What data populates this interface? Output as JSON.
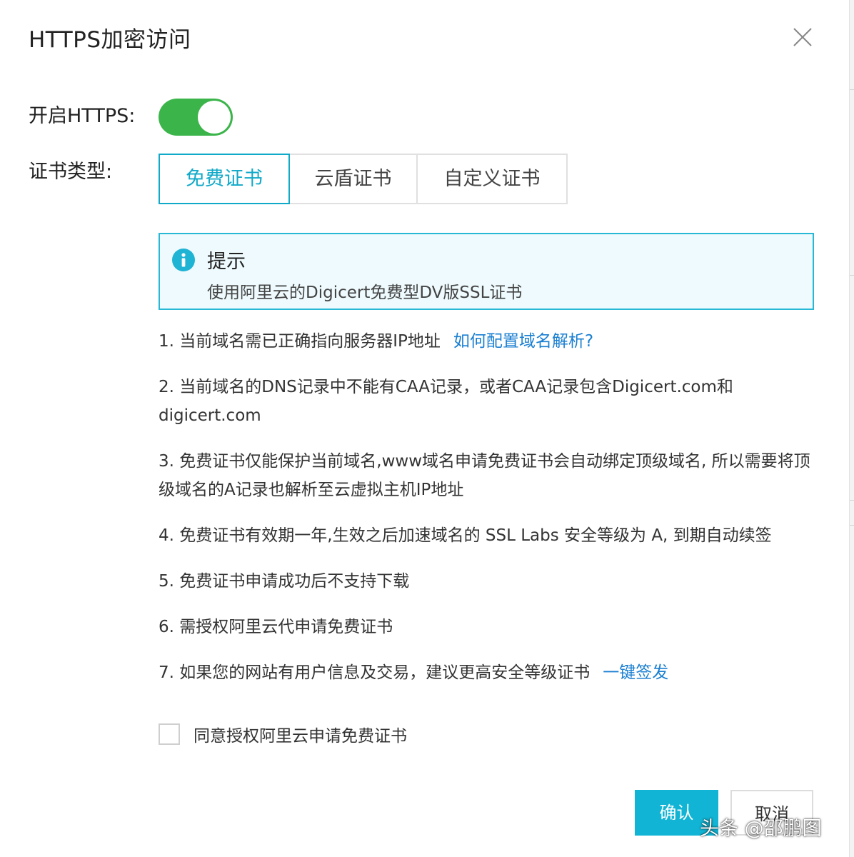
{
  "dialog": {
    "title": "HTTPS加密访问",
    "close_icon": "close-icon"
  },
  "https": {
    "label": "开启HTTPS:",
    "enabled": true,
    "switch_color": "#3bb54a"
  },
  "cert_type": {
    "label": "证书类型:",
    "tabs": [
      {
        "label": "免费证书",
        "active": true
      },
      {
        "label": "云盾证书",
        "active": false
      },
      {
        "label": "自定义证书",
        "active": false
      }
    ],
    "accent": "#11a9c8"
  },
  "tip": {
    "icon": "info-icon",
    "title": "提示",
    "text": "使用阿里云的Digicert免费型DV版SSL证书"
  },
  "notes": [
    {
      "text": "1. 当前域名需已正确指向服务器IP地址",
      "link": "如何配置域名解析?"
    },
    {
      "text": "2. 当前域名的DNS记录中不能有CAA记录，或者CAA记录包含Digicert.com和digicert.com"
    },
    {
      "text": "3. 免费证书仅能保护当前域名,www域名申请免费证书会自动绑定顶级域名, 所以需要将顶级域名的A记录也解析至云虚拟主机IP地址"
    },
    {
      "text": "4. 免费证书有效期一年,生效之后加速域名的 SSL Labs 安全等级为 A, 到期自动续签"
    },
    {
      "text": "5. 免费证书申请成功后不支持下载"
    },
    {
      "text": "6. 需授权阿里云代申请免费证书"
    },
    {
      "text": "7. 如果您的网站有用户信息及交易，建议更高安全等级证书",
      "link": "一键签发"
    }
  ],
  "agree": {
    "label": "同意授权阿里云申请免费证书",
    "checked": false
  },
  "footer": {
    "confirm": "确认",
    "cancel": "取消",
    "confirm_color": "#11b4d4"
  },
  "watermark": "头条 @邵鹏图"
}
